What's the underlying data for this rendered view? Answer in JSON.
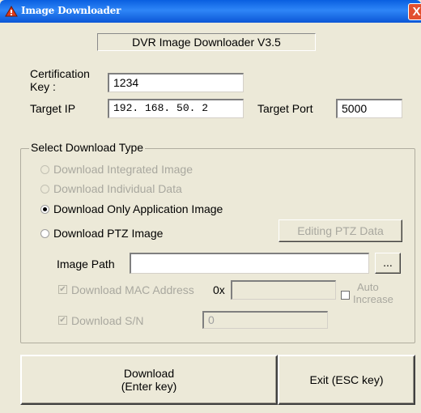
{
  "window": {
    "title": "Image Downloader",
    "close_glyph": "X"
  },
  "header": {
    "version": "DVR Image Downloader V3.5"
  },
  "certification": {
    "label_line1": "Certification",
    "label_line2": "Key :",
    "value": "1234"
  },
  "target_ip": {
    "label": "Target IP",
    "value": "192. 168. 50. 2"
  },
  "target_port": {
    "label": "Target Port",
    "value": "5000"
  },
  "download_type": {
    "group_label": "Select Download Type",
    "options": [
      {
        "label": "Download Integrated Image",
        "enabled": false,
        "checked": false
      },
      {
        "label": "Download Individual Data",
        "enabled": false,
        "checked": false
      },
      {
        "label": "Download Only Application Image",
        "enabled": true,
        "checked": true
      },
      {
        "label": "Download PTZ Image",
        "enabled": true,
        "checked": false
      }
    ],
    "editing_ptz_button": "Editing PTZ Data",
    "image_path": {
      "label": "Image Path",
      "value": "",
      "browse_label": "..."
    },
    "mac": {
      "label": "Download MAC Address",
      "prefix": "0x",
      "value": "",
      "checked": true
    },
    "auto_increase": {
      "label_line1": "Auto",
      "label_line2": "Increase",
      "checked": false
    },
    "sn": {
      "label": "Download S/N",
      "value": "0",
      "checked": true
    }
  },
  "actions": {
    "download_line1": "Download",
    "download_line2": "(Enter key)",
    "exit_label": "Exit (ESC key)"
  },
  "icons": {
    "app": "app-warning-icon",
    "close": "close-icon",
    "check": "checkmark-icon"
  },
  "colors": {
    "titlebar": "#0a5fe0",
    "window_bg": "#ece9d8",
    "close": "#e2502f"
  }
}
